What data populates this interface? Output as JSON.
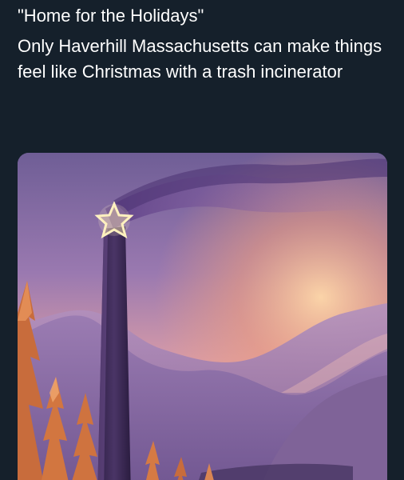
{
  "post": {
    "title": "\"Home for the Holidays\"",
    "body": "Only Haverhill Massachusetts can make things feel like Christmas with a trash incinerator"
  },
  "media": {
    "description_icon": "painting-image",
    "colors": {
      "background": "#15202b",
      "sky_top": "#7a6aa0",
      "sky_glow": "#f2a26a",
      "mountain": "#8a6fa6",
      "tower": "#3d2a52",
      "star": "#fff3c2",
      "trees": "#d5763a"
    }
  }
}
